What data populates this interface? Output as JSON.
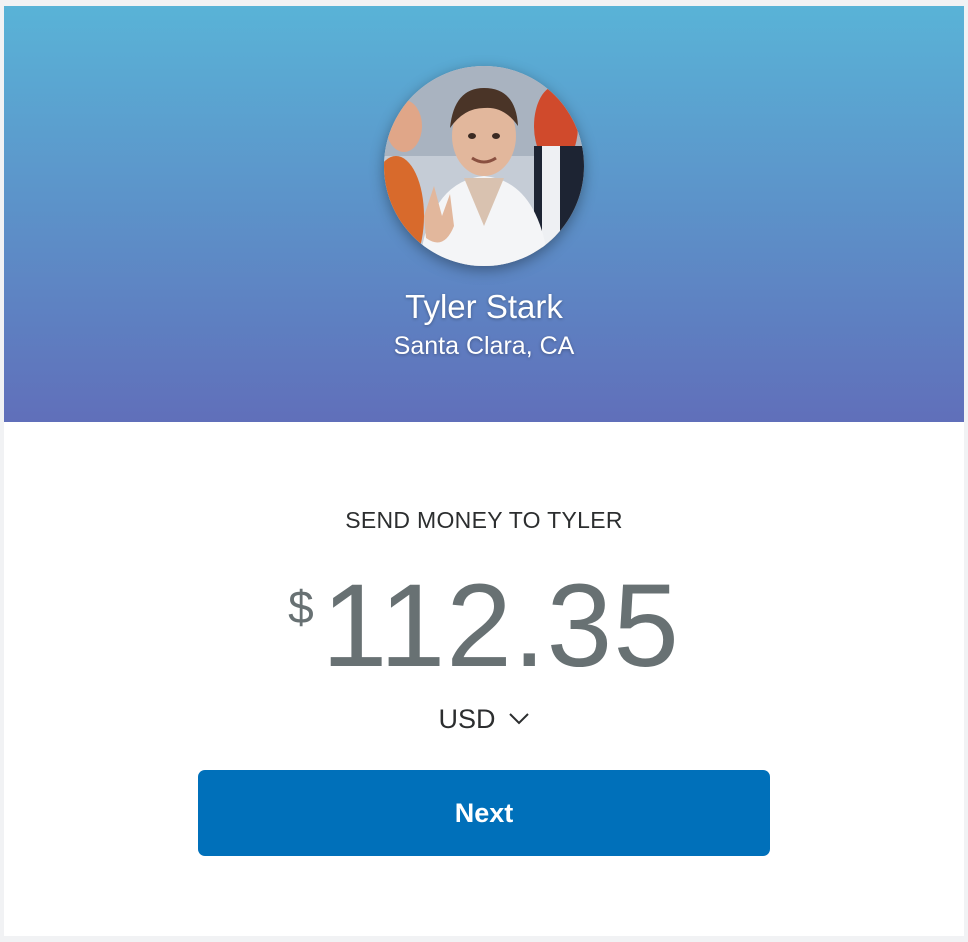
{
  "recipient": {
    "name": "Tyler Stark",
    "location": "Santa Clara, CA",
    "avatar_icon": "user-avatar-photo"
  },
  "payment": {
    "title": "SEND MONEY TO TYLER",
    "currency_symbol": "$",
    "amount": "112.35",
    "currency": "USD",
    "currency_chevron_icon": "chevron-down-icon"
  },
  "actions": {
    "next_label": "Next"
  },
  "colors": {
    "header_gradient_top": "#59b3d7",
    "header_gradient_bottom": "#606fba",
    "primary_button": "#0070ba",
    "amount_text": "#687173"
  }
}
